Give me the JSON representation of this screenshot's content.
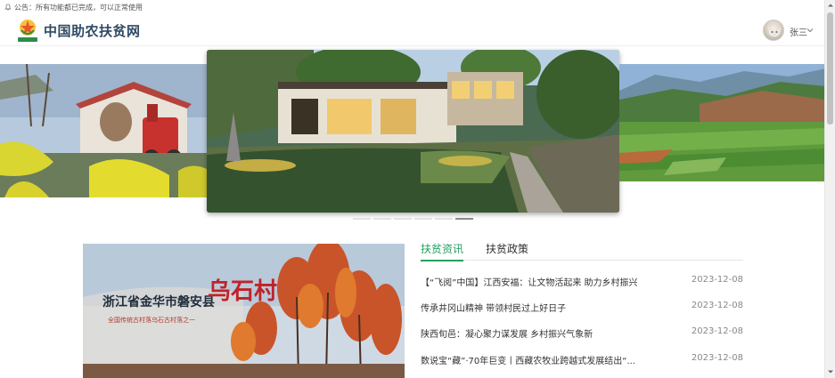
{
  "notice": {
    "text": "公告：所有功能都已完成，可以正常使用",
    "icon": "bell-icon"
  },
  "header": {
    "logo_caption": "扶贫助农",
    "site_title": "中国助农扶贫网",
    "user": {
      "name": "张三",
      "avatar": "avatar-cat-photo",
      "caret": "chevron-down-icon"
    },
    "brand_color": "#2f4a64"
  },
  "carousel": {
    "slides": [
      "village-rapeseed-flowers",
      "farmhouse-courtyard-pond",
      "mountain-farmland"
    ],
    "active_index": 4,
    "dot_count": 6
  },
  "feature": {
    "title_line": "浙江省金华市磐安县",
    "title_big": "乌石村",
    "subtitle": "全国传统古村落乌石古村落之一"
  },
  "tabs": [
    {
      "label": "扶贫资讯",
      "active": true
    },
    {
      "label": "扶贫政策",
      "active": false
    }
  ],
  "accent_color": "#25a160",
  "news": [
    {
      "title": "【“飞阅”中国】江西安福：让文物活起来 助力乡村振兴",
      "date": "2023-12-08"
    },
    {
      "title": "传承井冈山精神 带领村民过上好日子",
      "date": "2023-12-08"
    },
    {
      "title": "陕西旬邑：凝心聚力谋发展 乡村振兴气象新",
      "date": "2023-12-08"
    },
    {
      "title": "数说宝“藏”·70年巨变丨西藏农牧业跨越式发展结出“...",
      "date": "2023-12-08"
    }
  ]
}
